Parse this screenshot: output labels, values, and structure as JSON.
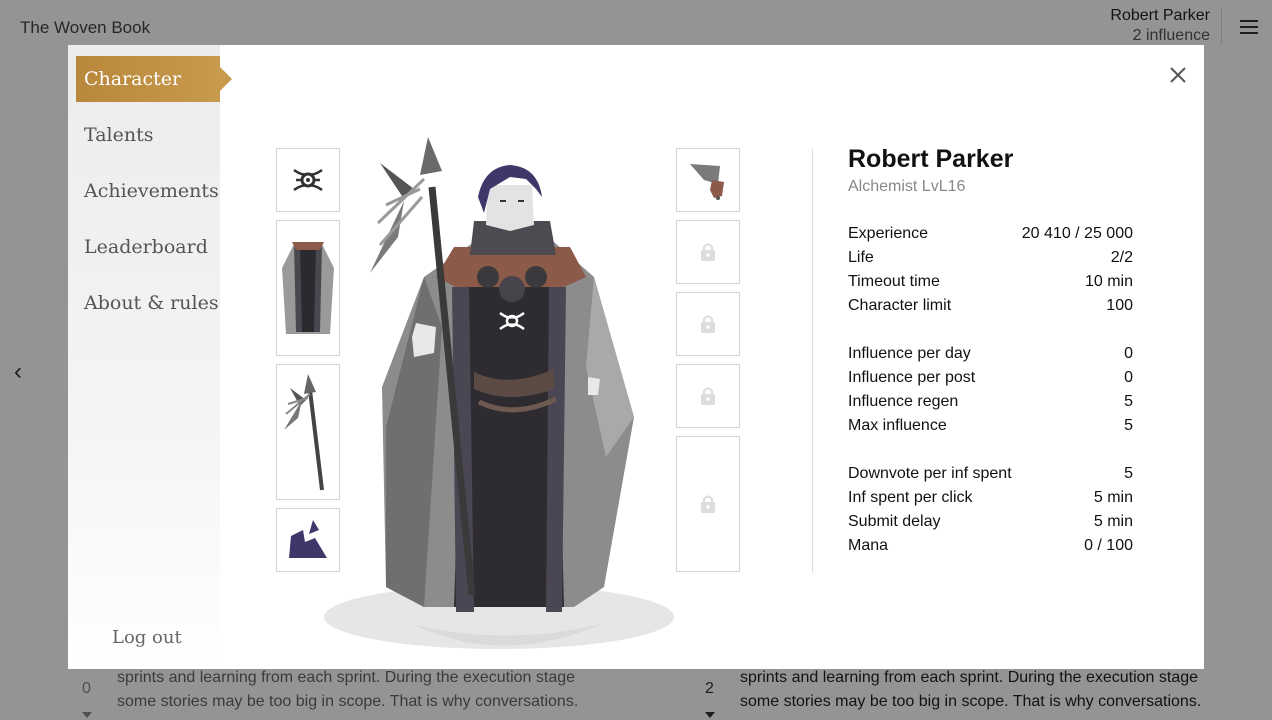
{
  "app": {
    "brand": "The Woven Book",
    "user_name": "Robert Parker",
    "user_influence": "2 influence"
  },
  "background": {
    "left_vote_count": "0",
    "right_vote_count": "2",
    "left_text": "sprints and learning from each sprint. During the execution stage some stories may be too big in scope. That is why conversations.",
    "right_text": "sprints and learning from each sprint. During the execution stage some stories may be too big in scope. That is why conversations."
  },
  "nav": {
    "items": [
      {
        "label": "Character",
        "active": true
      },
      {
        "label": "Talents"
      },
      {
        "label": "Achievements"
      },
      {
        "label": "Leaderboard"
      },
      {
        "label": "About & rules"
      }
    ],
    "logout": "Log out"
  },
  "equipment": {
    "left_slots": [
      "emblem-icon",
      "robe-icon",
      "spear-icon",
      "boots-icon"
    ],
    "right_slots": [
      "gloves-icon",
      "lock-icon",
      "lock-icon",
      "lock-icon",
      "lock-icon"
    ]
  },
  "character": {
    "name": "Robert Parker",
    "class_level": "Alchemist LvL16",
    "stats": [
      {
        "label": "Experience",
        "value": "20 410 / 25 000"
      },
      {
        "label": "Life",
        "value": "2/2"
      },
      {
        "label": "Timeout time",
        "value": "10 min"
      },
      {
        "label": "Character limit",
        "value": "100"
      },
      {
        "label": "Influence per day",
        "value": "0"
      },
      {
        "label": "Influence per post",
        "value": "0"
      },
      {
        "label": "Influence regen",
        "value": "5"
      },
      {
        "label": "Max influence",
        "value": "5"
      },
      {
        "label": "Downvote per inf spent",
        "value": "5"
      },
      {
        "label": "Inf spent per click",
        "value": "5 min"
      },
      {
        "label": "Submit delay",
        "value": "5 min"
      },
      {
        "label": "Mana",
        "value": "0 / 100"
      }
    ]
  },
  "colors": {
    "accent": "#c39446",
    "robe_dark": "#3e3a40",
    "robe_grey": "#8a8a8a",
    "hair": "#3d3869",
    "leather": "#8b5a48"
  }
}
